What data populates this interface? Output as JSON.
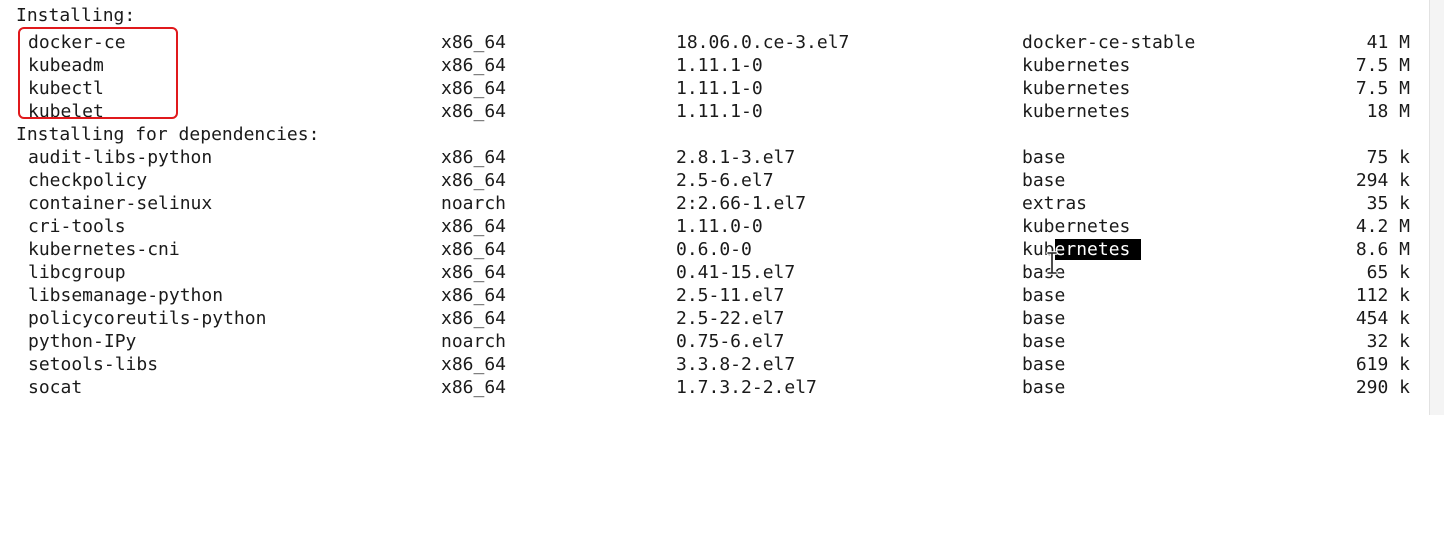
{
  "terminal": {
    "section_installing": "Installing:",
    "section_dependencies": "Installing for dependencies:",
    "installing": [
      {
        "name": "docker-ce",
        "arch": "x86_64",
        "version": "18.06.0.ce-3.el7",
        "repo": "docker-ce-stable",
        "size": "41 M"
      },
      {
        "name": "kubeadm",
        "arch": "x86_64",
        "version": "1.11.1-0",
        "repo": "kubernetes",
        "size": "7.5 M"
      },
      {
        "name": "kubectl",
        "arch": "x86_64",
        "version": "1.11.1-0",
        "repo": "kubernetes",
        "size": "7.5 M"
      },
      {
        "name": "kubelet",
        "arch": "x86_64",
        "version": "1.11.1-0",
        "repo": "kubernetes",
        "size": "18 M"
      }
    ],
    "dependencies": [
      {
        "name": "audit-libs-python",
        "arch": "x86_64",
        "version": "2.8.1-3.el7",
        "repo": "base",
        "size": "75 k"
      },
      {
        "name": "checkpolicy",
        "arch": "x86_64",
        "version": "2.5-6.el7",
        "repo": "base",
        "size": "294 k"
      },
      {
        "name": "container-selinux",
        "arch": "noarch",
        "version": "2:2.66-1.el7",
        "repo": "extras",
        "size": "35 k"
      },
      {
        "name": "cri-tools",
        "arch": "x86_64",
        "version": "1.11.0-0",
        "repo": "kubernetes",
        "size": "4.2 M"
      },
      {
        "name": "kubernetes-cni",
        "arch": "x86_64",
        "version": "0.6.0-0",
        "repo_unselected": "kub",
        "repo_selected": "ernetes ",
        "size": "8.6 M"
      },
      {
        "name": "libcgroup",
        "arch": "x86_64",
        "version": "0.41-15.el7",
        "repo": "base",
        "size": "65 k"
      },
      {
        "name": "libsemanage-python",
        "arch": "x86_64",
        "version": "2.5-11.el7",
        "repo": "base",
        "size": "112 k"
      },
      {
        "name": "policycoreutils-python",
        "arch": "x86_64",
        "version": "2.5-22.el7",
        "repo": "base",
        "size": "454 k"
      },
      {
        "name": "python-IPy",
        "arch": "noarch",
        "version": "0.75-6.el7",
        "repo": "base",
        "size": "32 k"
      },
      {
        "name": "setools-libs",
        "arch": "x86_64",
        "version": "3.3.8-2.el7",
        "repo": "base",
        "size": "619 k"
      },
      {
        "name": "socat",
        "arch": "x86_64",
        "version": "1.7.3.2-2.el7",
        "repo": "base",
        "size": "290 k"
      }
    ]
  },
  "annotation": {
    "color": "#e0191c"
  },
  "cursor": {
    "icon": "text-cursor-icon"
  }
}
